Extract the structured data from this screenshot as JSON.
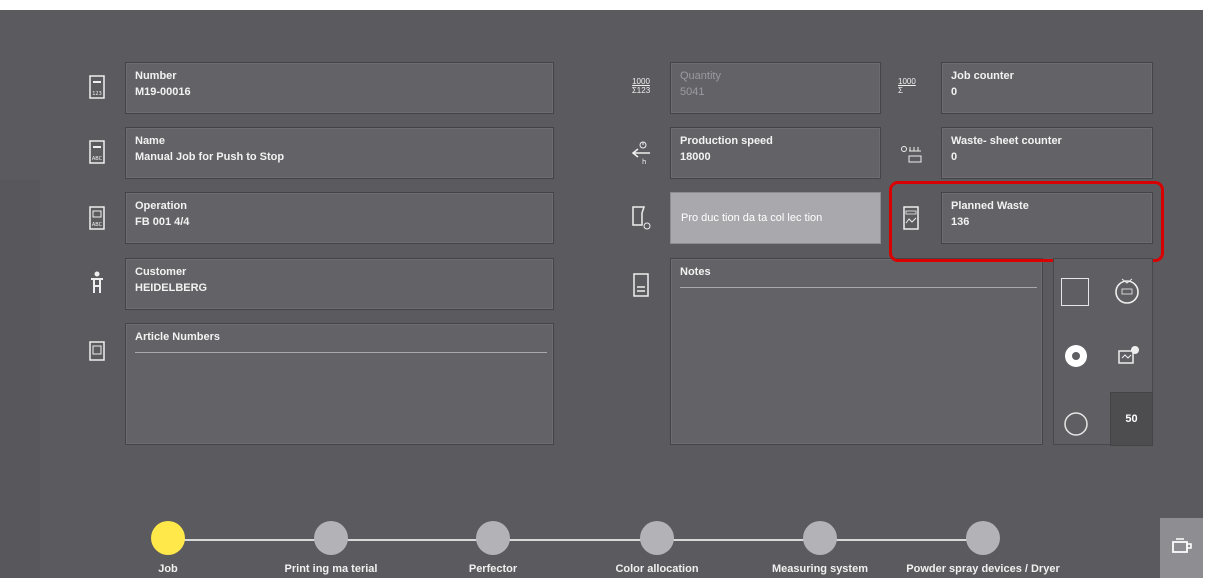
{
  "left_fields": [
    {
      "key": "number",
      "label": "Number",
      "value": "M19-00016",
      "icon": "job-number-icon"
    },
    {
      "key": "name",
      "label": "Name",
      "value": "Manual Job for Push to Stop",
      "icon": "job-name-icon"
    },
    {
      "key": "operation",
      "label": "Operation",
      "value": "FB 001  4/4",
      "icon": "operation-icon"
    },
    {
      "key": "customer",
      "label": "Customer",
      "value": "HEIDELBERG",
      "icon": "customer-icon"
    }
  ],
  "article_numbers": {
    "label": "Article Numbers",
    "icon": "article-icon"
  },
  "quantity": {
    "label": "Quantity",
    "value": "5041",
    "icon": "quantity-icon",
    "icon_text_top": "1000",
    "icon_text_bottom": "Σ123"
  },
  "job_counter": {
    "label": "Job counter",
    "value": "0",
    "icon": "job-counter-icon",
    "icon_text_top": "1000",
    "icon_text_bottom": "Σ"
  },
  "production_speed": {
    "label": "Production speed",
    "value": "18000",
    "icon": "speed-icon"
  },
  "waste_sheet_counter": {
    "label": "Waste- sheet counter",
    "value": "0",
    "icon": "waste-counter-icon"
  },
  "production_data_collection": {
    "label": "Pro duc tion da ta col lec tion",
    "icon": "data-collection-icon"
  },
  "planned_waste": {
    "label": "Planned Waste",
    "value": "136",
    "icon": "planned-waste-icon"
  },
  "notes": {
    "label": "Notes",
    "icon": "notes-icon"
  },
  "side_panel": {
    "count": "50"
  },
  "timeline": {
    "steps": [
      {
        "label": "Job",
        "active": true
      },
      {
        "label": "Print ing ma terial",
        "active": false
      },
      {
        "label": "Perfector",
        "active": false
      },
      {
        "label": "Color allocation",
        "active": false
      },
      {
        "label": "Measuring system",
        "active": false
      },
      {
        "label": "Powder spray devices / Dryer",
        "active": false
      }
    ]
  },
  "colors": {
    "background": "#5b5b5f",
    "field": "#636367",
    "highlight": "#d90000",
    "active_step": "#ffe84a",
    "inactive_step": "#b3b3b7"
  }
}
